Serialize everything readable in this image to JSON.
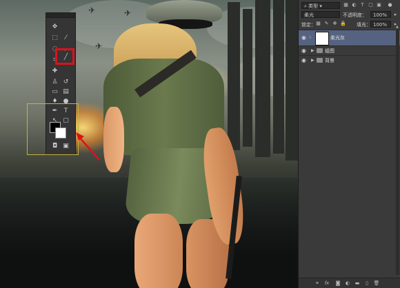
{
  "tools_panel": {
    "icons": [
      "move-icon",
      "marquee-icon",
      "lasso-icon",
      "magic-wand-icon",
      "crop-icon",
      "eyedropper-icon",
      "healing-icon",
      "brush-icon",
      "stamp-icon",
      "history-brush-icon",
      "eraser-icon",
      "gradient-icon",
      "blur-icon",
      "dodge-icon",
      "pen-icon",
      "type-icon",
      "path-select-icon",
      "shape-icon",
      "hand-icon",
      "zoom-icon"
    ],
    "selected_tool": "brush-icon",
    "foreground_color": "#000000",
    "background_color": "#ffffff"
  },
  "annotations": {
    "highlight_color": "#e0101a",
    "frame_color": "#c6b43a"
  },
  "layers_panel": {
    "filter_kind": "类型",
    "blend_mode": "柔光",
    "opacity_label": "不透明度：",
    "opacity_value": "100%",
    "lock_label": "锁定：",
    "fill_label": "填充：",
    "fill_value": "100%",
    "layers": [
      {
        "name": "柔光灰",
        "selected": true,
        "type": "layer"
      },
      {
        "name": "组图",
        "selected": false,
        "type": "group"
      },
      {
        "name": "背景",
        "selected": false,
        "type": "group"
      }
    ],
    "footer_icons": [
      "link-icon",
      "fx-icon",
      "mask-icon",
      "adjustment-icon",
      "group-icon",
      "new-layer-icon",
      "trash-icon"
    ]
  }
}
